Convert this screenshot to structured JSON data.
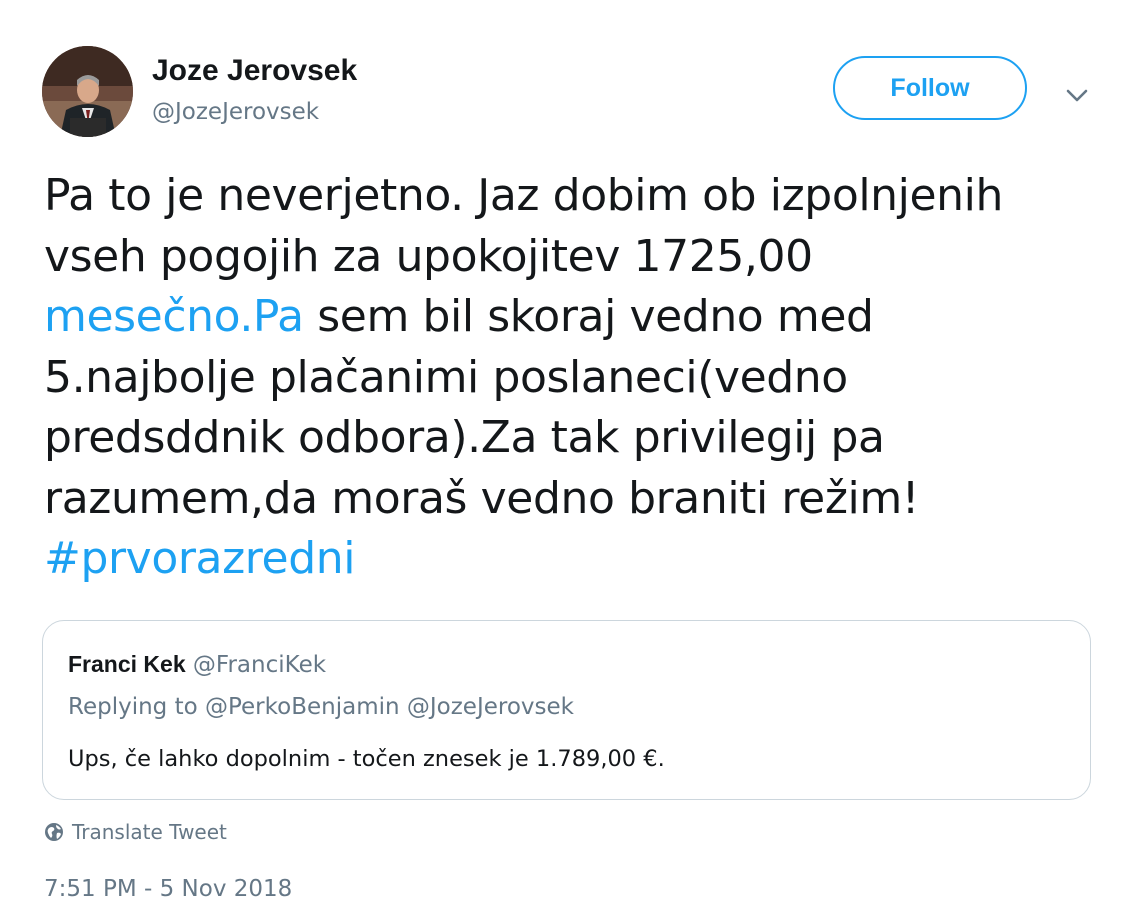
{
  "author": {
    "display_name": "Joze Jerovsek",
    "handle": "@JozeJerovsek"
  },
  "follow_button_label": "Follow",
  "tweet": {
    "lines": [
      [
        {
          "text": "Pa to je neverjetno. Jaz dobim ob izpolnjenih"
        }
      ],
      [
        {
          "text": "vseh pogojih za upokojitev 1725,00"
        }
      ],
      [
        {
          "text": "mesečno.Pa",
          "link": true
        },
        {
          "text": " sem bil skoraj vedno med"
        }
      ],
      [
        {
          "text": "5.najbolje plačanimi poslaneci(vedno"
        }
      ],
      [
        {
          "text": "predsddnik odbora).Za tak privilegij pa"
        }
      ],
      [
        {
          "text": "razumem,da moraš vedno braniti režim!"
        }
      ],
      [
        {
          "text": "#prvorazredni",
          "link": true
        }
      ]
    ]
  },
  "quoted_tweet": {
    "display_name": "Franci Kek",
    "handle": "@FranciKek",
    "replying_to": "Replying to @PerkoBenjamin @JozeJerovsek",
    "text": "Ups, če lahko dopolnim - točen znesek je 1.789,00 €."
  },
  "translate_label": "Translate Tweet",
  "timestamp": "7:51 PM - 5 Nov 2018",
  "colors": {
    "accent": "#1da1f2",
    "text": "#14171a",
    "secondary": "#657786",
    "border": "#ccd6dd"
  },
  "icons": {
    "more": "chevron-down-icon",
    "translate": "globe-icon"
  }
}
